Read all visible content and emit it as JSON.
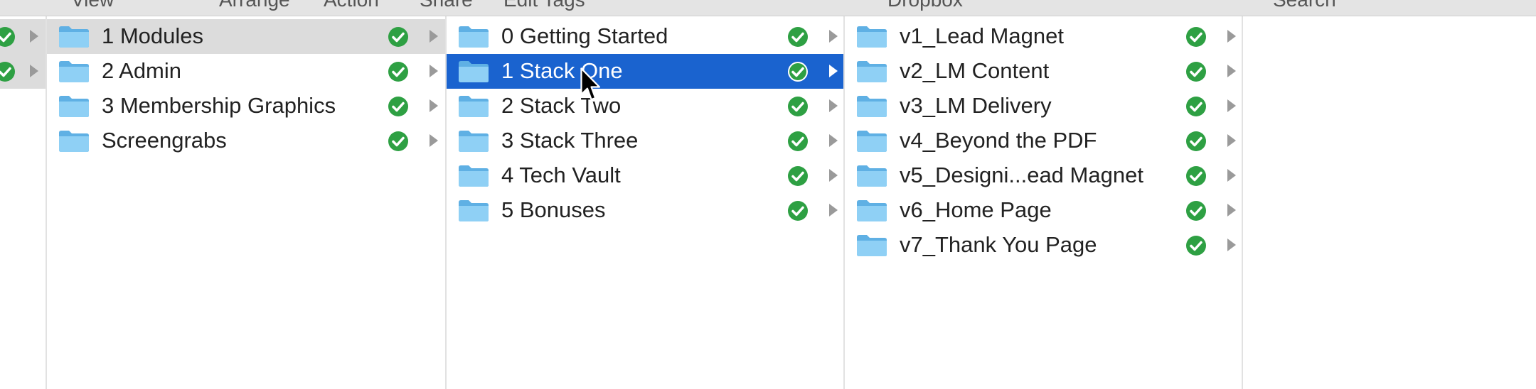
{
  "toolbar": {
    "labels": [
      "View",
      "Arrange",
      "Action",
      "Share",
      "Edit Tags",
      "Dropbox",
      "Search"
    ]
  },
  "colors": {
    "selection": "#1a63cf",
    "active_parent": "#dcdcdc",
    "sync_ok": "#2ea043",
    "folder": "#7cc4ee"
  },
  "columns": {
    "col1": {
      "items": [
        {
          "label": "1 Modules",
          "state": "active-parent"
        },
        {
          "label": "2 Admin",
          "state": ""
        },
        {
          "label": "3 Membership Graphics",
          "state": ""
        },
        {
          "label": "Screengrabs",
          "state": ""
        }
      ]
    },
    "col2": {
      "items": [
        {
          "label": "0 Getting Started",
          "state": ""
        },
        {
          "label": "1 Stack One",
          "state": "selected"
        },
        {
          "label": "2 Stack Two",
          "state": ""
        },
        {
          "label": "3 Stack Three",
          "state": ""
        },
        {
          "label": "4 Tech Vault",
          "state": ""
        },
        {
          "label": "5 Bonuses",
          "state": ""
        }
      ]
    },
    "col3": {
      "items": [
        {
          "label": "v1_Lead Magnet",
          "state": ""
        },
        {
          "label": "v2_LM Content",
          "state": ""
        },
        {
          "label": "v3_LM Delivery",
          "state": ""
        },
        {
          "label": "v4_Beyond the PDF",
          "state": ""
        },
        {
          "label": "v5_Designi...ead Magnet",
          "state": ""
        },
        {
          "label": "v6_Home Page",
          "state": ""
        },
        {
          "label": "v7_Thank You Page",
          "state": ""
        }
      ]
    }
  },
  "icons": {
    "folder": "folder-icon",
    "sync": "sync-check-icon",
    "disclosure": "disclosure-arrow-icon",
    "cursor": "mouse-pointer-icon"
  }
}
